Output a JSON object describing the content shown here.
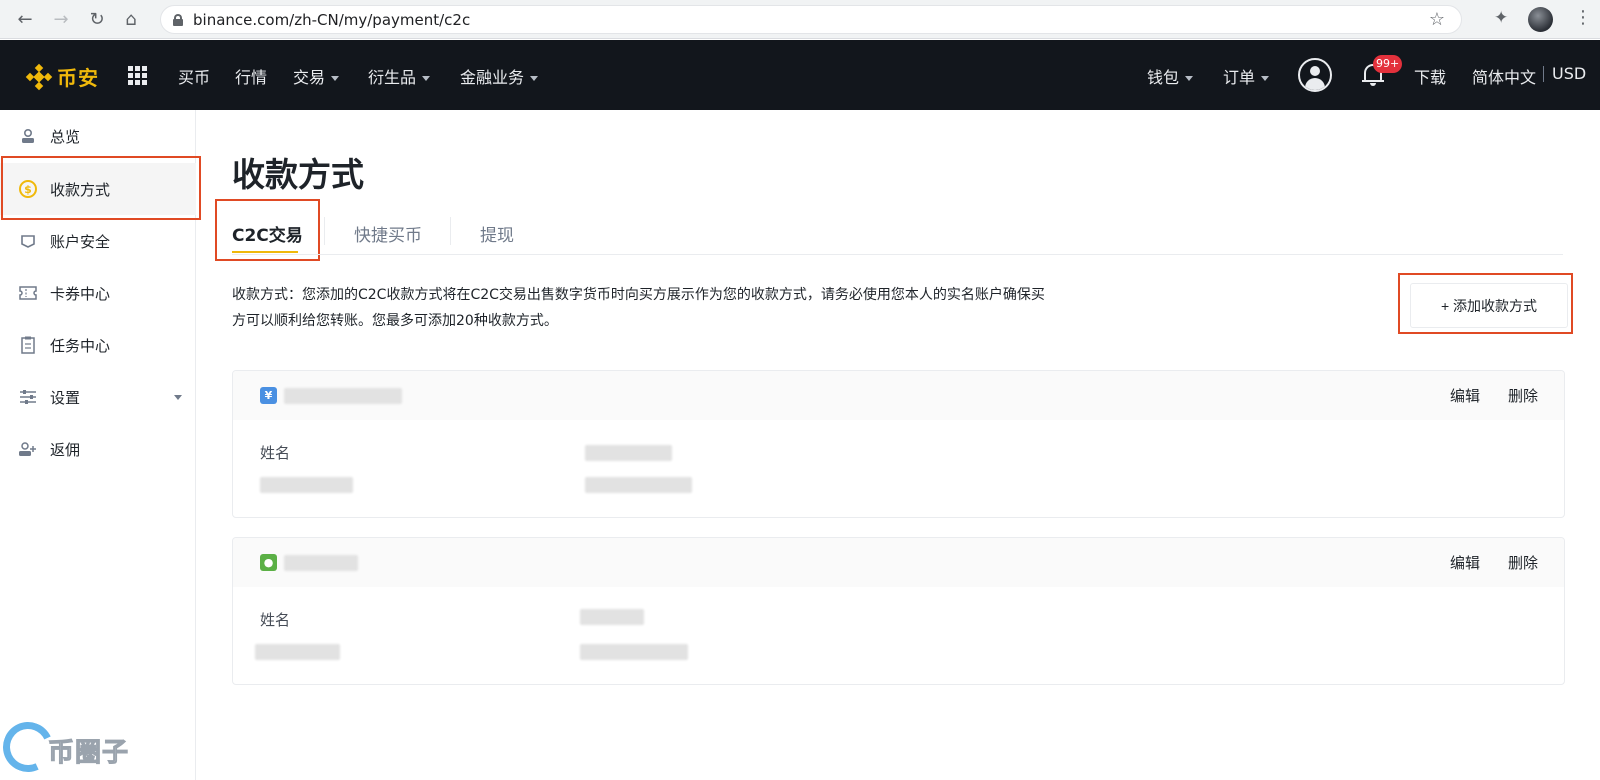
{
  "browser": {
    "url": "binance.com/zh-CN/my/payment/c2c"
  },
  "nav": {
    "logo_text": "币安",
    "items": [
      "买币",
      "行情",
      "交易",
      "衍生品",
      "金融业务"
    ],
    "wallet": "钱包",
    "orders": "订单",
    "notification_count": "99+",
    "download": "下载",
    "language": "简体中文",
    "currency": "USD"
  },
  "sidebar": {
    "items": [
      {
        "label": "总览",
        "icon": "user-icon"
      },
      {
        "label": "收款方式",
        "icon": "dollar-icon"
      },
      {
        "label": "账户安全",
        "icon": "shield-icon"
      },
      {
        "label": "卡券中心",
        "icon": "ticket-icon"
      },
      {
        "label": "任务中心",
        "icon": "clipboard-icon"
      },
      {
        "label": "设置",
        "icon": "sliders-icon"
      },
      {
        "label": "返佣",
        "icon": "add-user-icon"
      }
    ]
  },
  "main": {
    "title": "收款方式",
    "tabs": [
      "C2C交易",
      "快捷买币",
      "提现"
    ],
    "description": "收款方式：您添加的C2C收款方式将在C2C交易出售数字货币时向买方展示作为您的收款方式，请务必使用您本人的实名账户确保买方可以顺利给您转账。您最多可添加20种收款方式。",
    "add_button": "+  添加收款方式",
    "cards": [
      {
        "icon": "yuan-icon",
        "icon_glyph": "¥",
        "icon_color": "#4a90e2",
        "edit": "编辑",
        "delete": "删除",
        "name_label": "姓名"
      },
      {
        "icon": "wechat-icon",
        "icon_glyph": "●",
        "icon_color": "#5bb046",
        "edit": "编辑",
        "delete": "删除",
        "name_label": "姓名"
      }
    ]
  },
  "watermark": {
    "text": "币圈子"
  },
  "colors": {
    "brand": "#f0b90b",
    "nav_bg": "#12161c",
    "highlight": "#e04a24"
  }
}
